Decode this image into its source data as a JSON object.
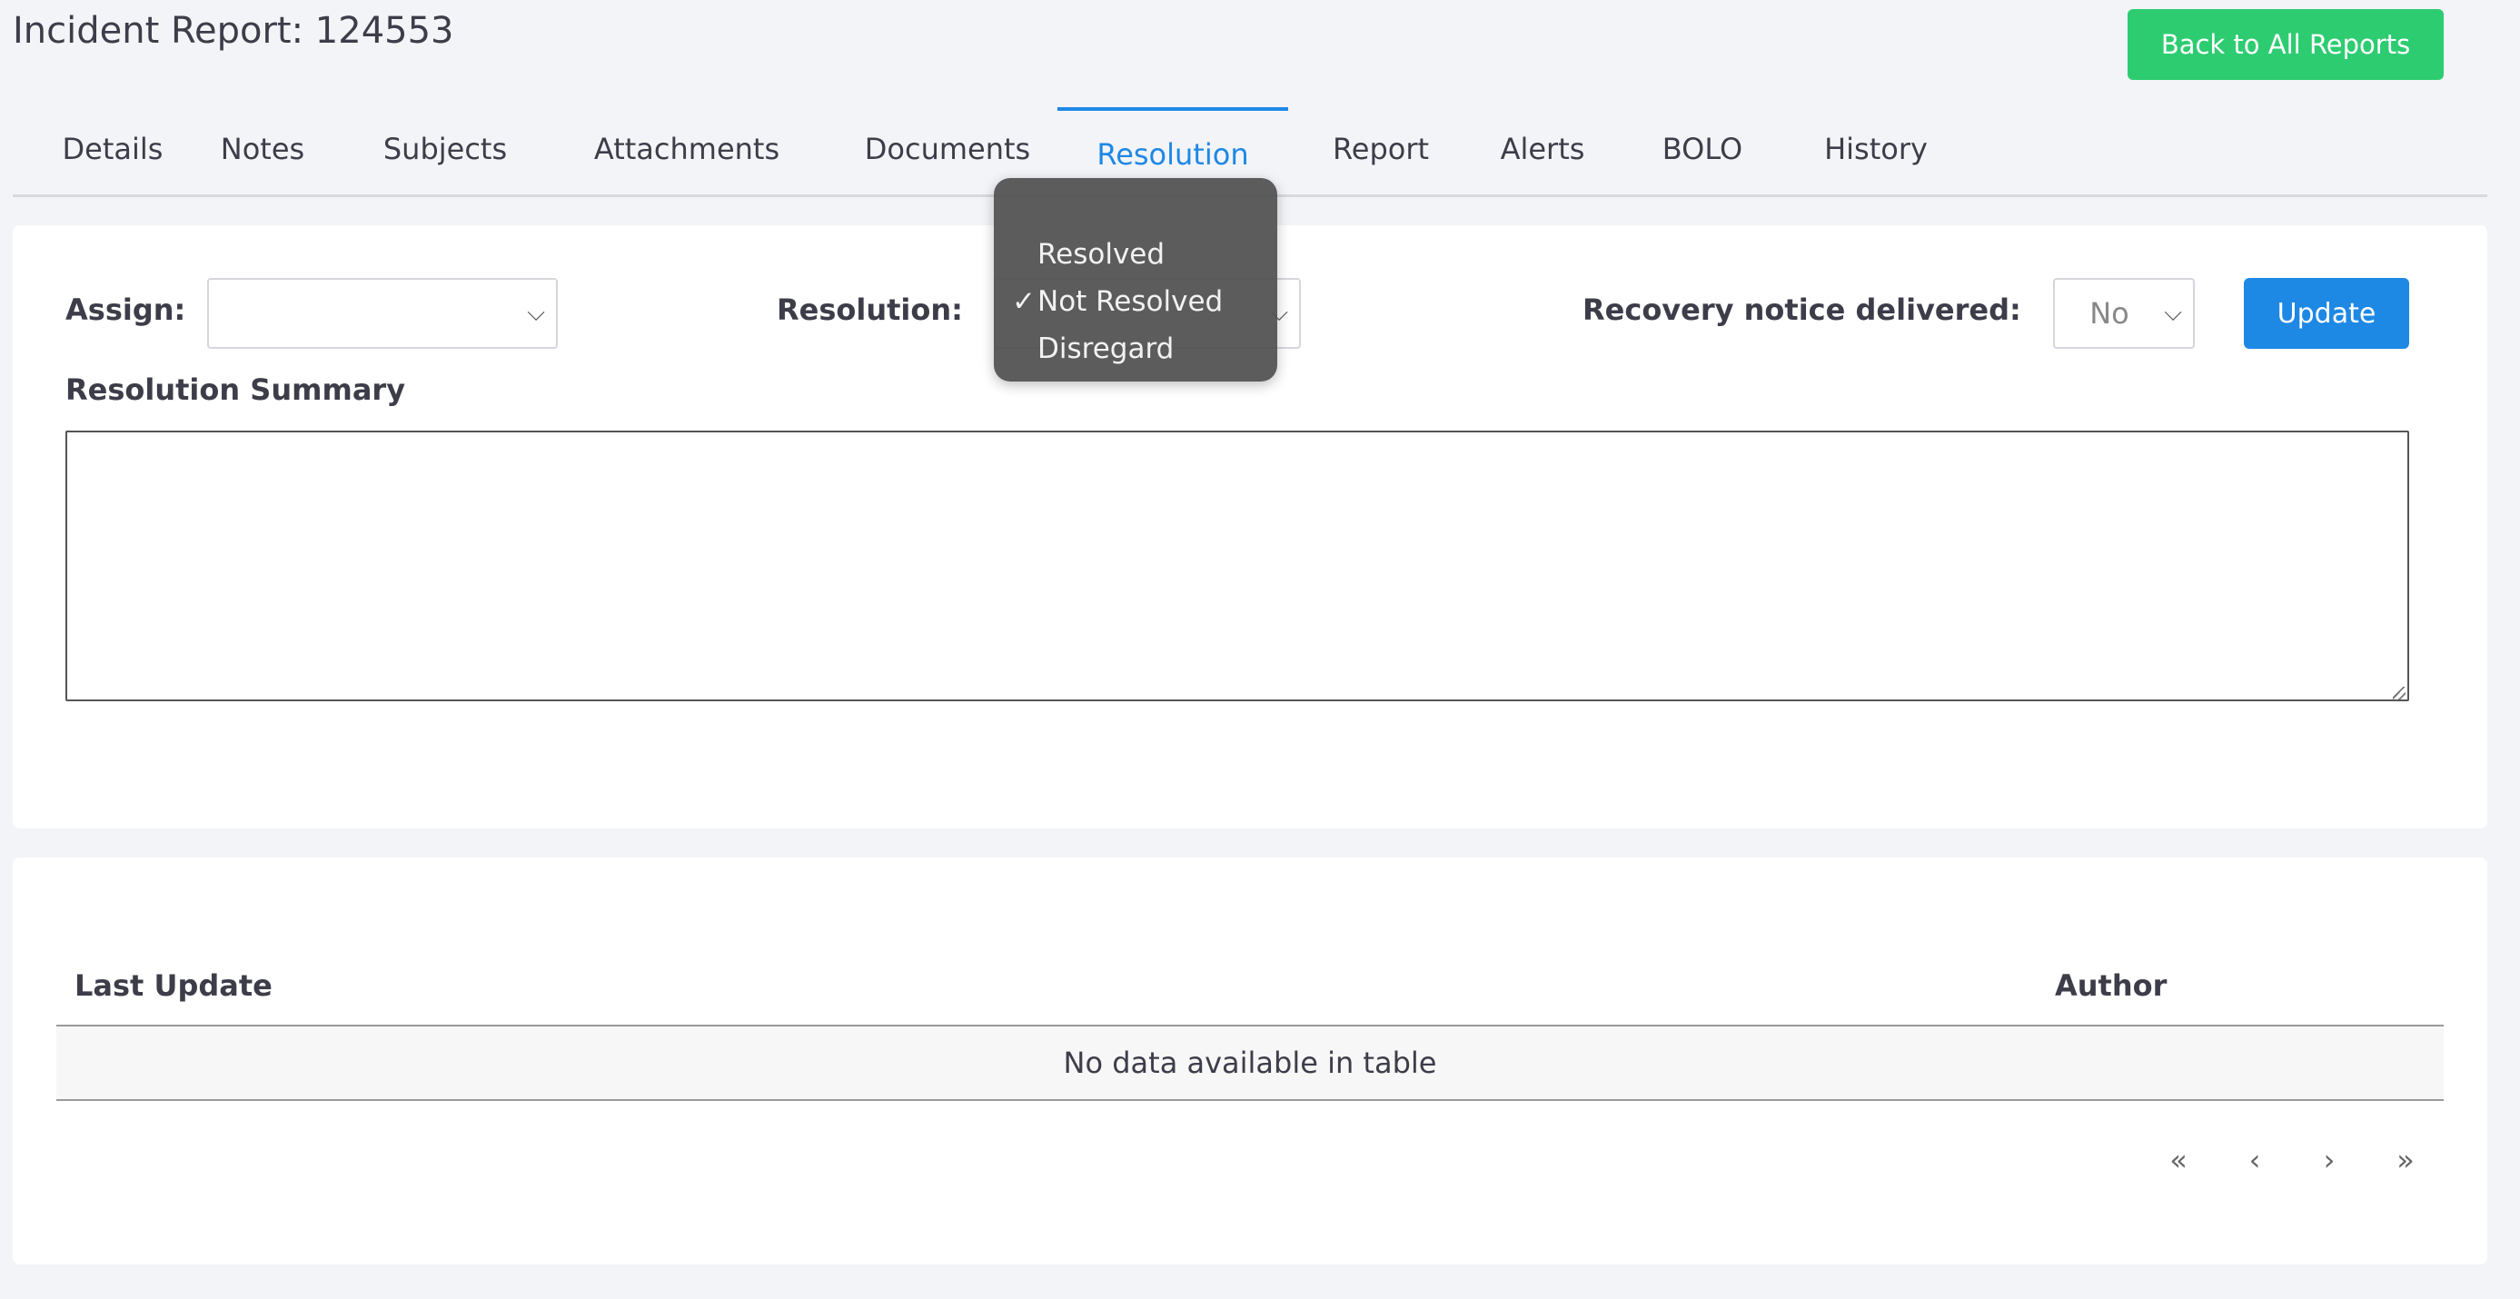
{
  "header": {
    "title": "Incident Report: 124553",
    "back_label": "Back to All Reports"
  },
  "tabs": [
    {
      "label": "Details"
    },
    {
      "label": "Notes"
    },
    {
      "label": "Subjects"
    },
    {
      "label": "Attachments"
    },
    {
      "label": "Documents"
    },
    {
      "label": "Resolution",
      "active": true
    },
    {
      "label": "Report"
    },
    {
      "label": "Alerts"
    },
    {
      "label": "BOLO"
    },
    {
      "label": "History"
    }
  ],
  "form": {
    "assign_label": "Assign:",
    "assign_value": "",
    "resolution_label": "Resolution:",
    "resolution_options": [
      "Resolved",
      "Not Resolved",
      "Disregard"
    ],
    "resolution_selected": "Not Resolved",
    "check_mark": "✓",
    "recovery_label": "Recovery notice delivered:",
    "recovery_value": "No",
    "update_label": "Update",
    "summary_label": "Resolution Summary",
    "summary_value": ""
  },
  "table": {
    "columns": [
      "Last Update",
      "Author"
    ],
    "empty_message": "No data available in table"
  },
  "pagination": {
    "first": "«",
    "prev": "‹",
    "next": "›",
    "last": "»"
  },
  "colors": {
    "accent": "#1e88e5",
    "success": "#2ecc71"
  }
}
